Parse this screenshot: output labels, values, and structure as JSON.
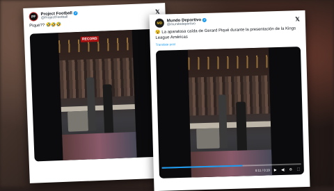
{
  "tweets": [
    {
      "author": "Project Football",
      "handle": "@ProjectFootball",
      "avatar_text": "PF",
      "text": "Piqué?? 🤣🤣🤣",
      "sign": "RECORD"
    },
    {
      "author": "Mundo Deportivo",
      "handle": "@mundodeportivo",
      "avatar_text": "MD",
      "text": "😵 La aparatosa caída de Gerard Piqué durante la presentación de la Kings League Américas",
      "translate": "Translate post",
      "video_time": "0:11 / 0:19",
      "progress": 0.58
    }
  ],
  "x_logo": "𝕏",
  "verified_mark": "✓",
  "icons": [
    "x-logo-icon",
    "verified-icon",
    "play-icon",
    "volume-icon",
    "settings-icon",
    "fullscreen-icon"
  ]
}
